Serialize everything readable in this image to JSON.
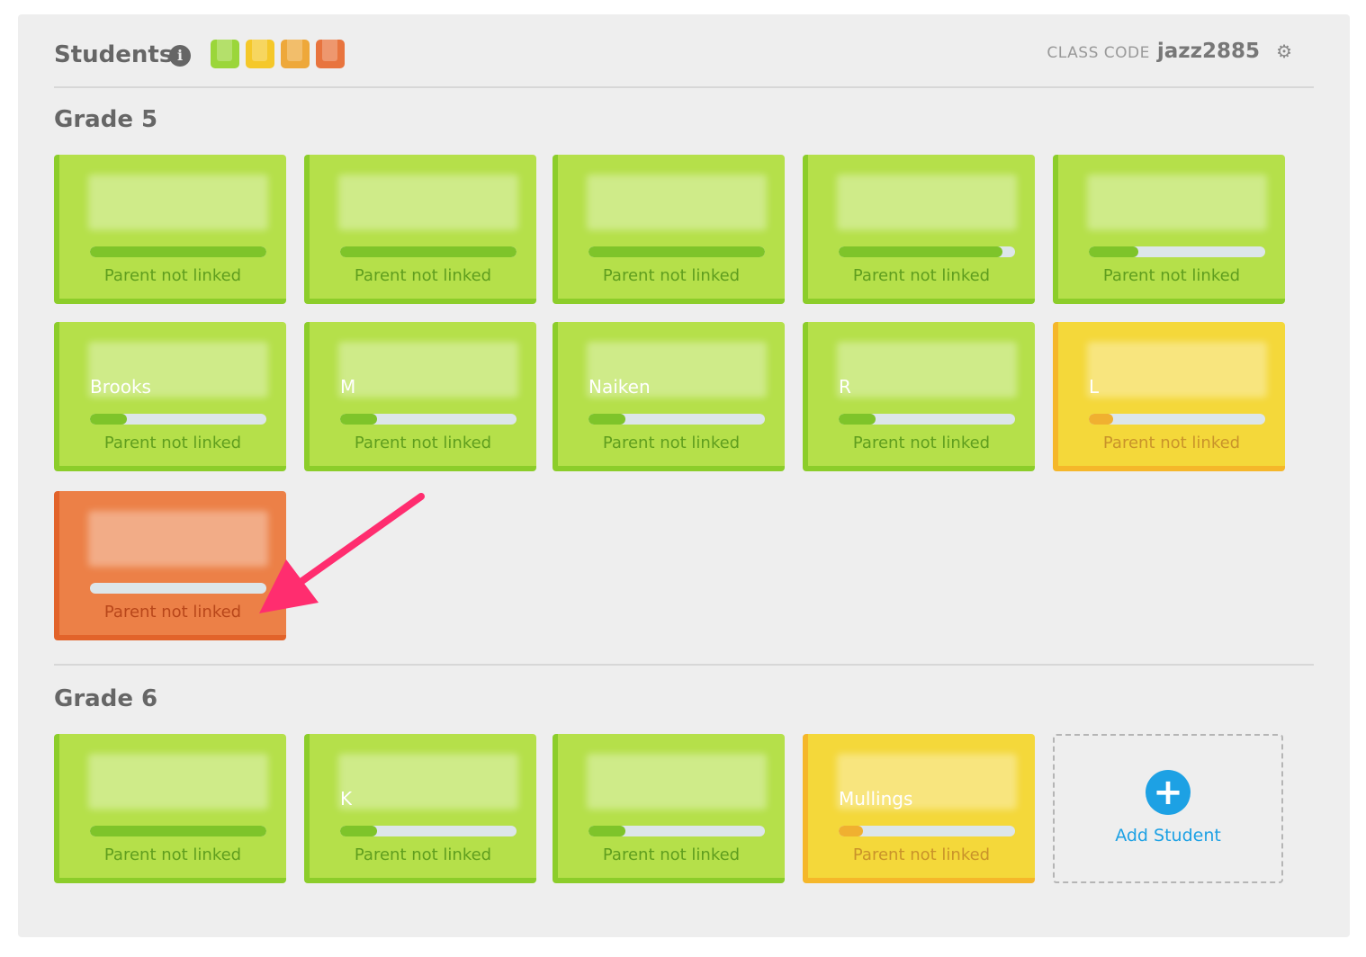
{
  "header": {
    "title": "Students",
    "info_icon": "info-icon",
    "legend_colors": [
      "#9bd63a",
      "#f5c82a",
      "#eea83a",
      "#e8743e"
    ],
    "class_code_label": "CLASS CODE",
    "class_code_value": "jazz2885",
    "settings_icon": "gear-icon"
  },
  "grades": [
    {
      "title": "Grade 5",
      "students": [
        {
          "name": "",
          "status": "Parent not linked",
          "color": "green",
          "progress": 1.0
        },
        {
          "name": "",
          "status": "Parent not linked",
          "color": "green",
          "progress": 1.0
        },
        {
          "name": "",
          "status": "Parent not linked",
          "color": "green",
          "progress": 1.0
        },
        {
          "name": "",
          "status": "Parent not linked",
          "color": "green",
          "progress": 0.93
        },
        {
          "name": "",
          "status": "Parent not linked",
          "color": "green",
          "progress": 0.28
        },
        {
          "name": "Brooks",
          "status": "Parent not linked",
          "color": "green",
          "progress": 0.21
        },
        {
          "name": "M",
          "status": "Parent not linked",
          "color": "green",
          "progress": 0.21
        },
        {
          "name": "Naiken",
          "status": "Parent not linked",
          "color": "green",
          "progress": 0.21
        },
        {
          "name": "R",
          "status": "Parent not linked",
          "color": "green",
          "progress": 0.21
        },
        {
          "name": "L",
          "status": "Parent not linked",
          "color": "yellow",
          "progress": 0.14
        },
        {
          "name": "",
          "status": "Parent not linked",
          "color": "orange",
          "progress": 0.0
        }
      ]
    },
    {
      "title": "Grade 6",
      "students": [
        {
          "name": "",
          "status": "Parent not linked",
          "color": "green",
          "progress": 1.0
        },
        {
          "name": "K",
          "status": "Parent not linked",
          "color": "green",
          "progress": 0.21
        },
        {
          "name": "",
          "status": "Parent not linked",
          "color": "green",
          "progress": 0.21
        },
        {
          "name": "Mullings",
          "status": "Parent not linked",
          "color": "yellow",
          "progress": 0.14
        }
      ]
    }
  ],
  "add_student": {
    "label": "Add Student",
    "icon": "plus-icon"
  },
  "annotation": {
    "arrow_color": "#ff2d6f"
  }
}
